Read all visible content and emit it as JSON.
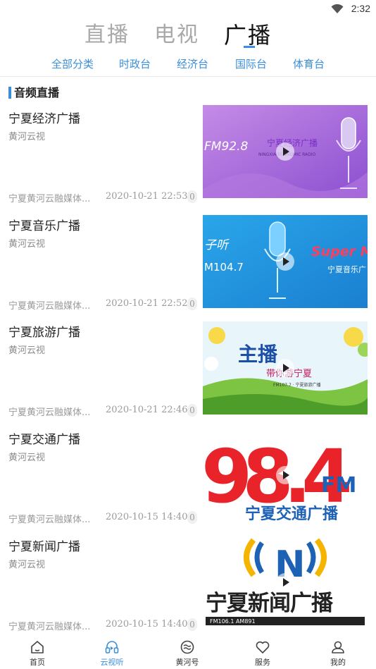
{
  "status_bar": {
    "time": "2:32"
  },
  "top_tabs": [
    {
      "label": "直播",
      "active": false
    },
    {
      "label": "电视",
      "active": false
    },
    {
      "label": "广播",
      "active": true
    }
  ],
  "sub_tabs": [
    "全部分类",
    "时政台",
    "经济台",
    "国际台",
    "体育台"
  ],
  "section": {
    "title": "音频直播"
  },
  "items": [
    {
      "title": "宁夏经济广播",
      "channel": "黄河云视",
      "source": "宁夏黄河云融媒体...",
      "date": "2020-10-21 22:53",
      "count": "0",
      "thumb_text": [
        "FM92.8",
        "宁夏经济广播",
        "NINGXIA ECONOMIC RADIO"
      ]
    },
    {
      "title": "宁夏音乐广播",
      "channel": "黄河云视",
      "source": "宁夏黄河云融媒体...",
      "date": "2020-10-21 22:52",
      "count": "0",
      "thumb_text": [
        "子听",
        "M104.7",
        "Super M",
        "宁夏音乐广"
      ]
    },
    {
      "title": "宁夏旅游广播",
      "channel": "黄河云视",
      "source": "宁夏黄河云融媒体...",
      "date": "2020-10-21 22:46",
      "count": "0",
      "thumb_text": [
        "主播",
        "带你游宁夏",
        "FM107.7 · 宁夏旅游广播"
      ]
    },
    {
      "title": "宁夏交通广播",
      "channel": "黄河云视",
      "source": "宁夏黄河云融媒体...",
      "date": "2020-10-15 14:40",
      "count": "0",
      "thumb_text": [
        "98.4",
        "FM",
        "宁夏交通广播"
      ]
    },
    {
      "title": "宁夏新闻广播",
      "channel": "黄河云视",
      "source": "宁夏黄河云融媒体...",
      "date": "2020-10-15 14:40",
      "count": "0",
      "thumb_text": [
        "N",
        "宁夏新闻广播",
        "FM106.1 AM891"
      ]
    }
  ],
  "bottom_nav": [
    {
      "label": "首页",
      "icon": "home-icon",
      "active": false
    },
    {
      "label": "云视听",
      "icon": "headphones-icon",
      "active": true
    },
    {
      "label": "黄河号",
      "icon": "river-icon",
      "active": false
    },
    {
      "label": "服务",
      "icon": "heart-icon",
      "active": false
    },
    {
      "label": "我的",
      "icon": "user-icon",
      "active": false
    }
  ],
  "colors": {
    "accent": "#3b8fd8",
    "tab_inactive": "#a9a9a9",
    "muted_text": "#9a9a9a"
  }
}
